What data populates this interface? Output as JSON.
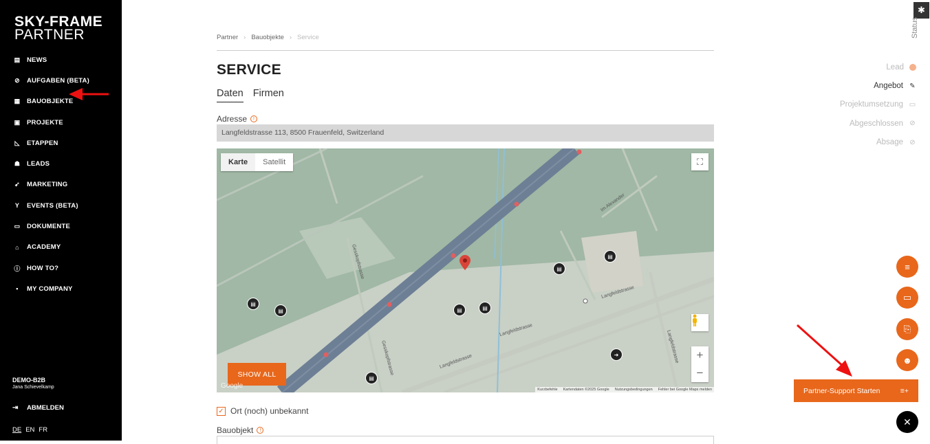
{
  "brand": {
    "line1": "SKY-FRAME",
    "line2": "PARTNER"
  },
  "nav": [
    {
      "label": "NEWS",
      "icon": "newspaper-icon",
      "glyph": "▤"
    },
    {
      "label": "AUFGABEN (BETA)",
      "icon": "check-circle-icon",
      "glyph": "⊘"
    },
    {
      "label": "BAUOBJEKTE",
      "icon": "building-icon",
      "glyph": "▦"
    },
    {
      "label": "PROJEKTE",
      "icon": "layers-icon",
      "glyph": "▣"
    },
    {
      "label": "ETAPPEN",
      "icon": "stairs-icon",
      "glyph": "◺"
    },
    {
      "label": "LEADS",
      "icon": "people-icon",
      "glyph": "☗"
    },
    {
      "label": "MARKETING",
      "icon": "megaphone-icon",
      "glyph": "➹"
    },
    {
      "label": "EVENTS (BETA)",
      "icon": "cocktail-icon",
      "glyph": "Y"
    },
    {
      "label": "DOKUMENTE",
      "icon": "document-icon",
      "glyph": "▭"
    },
    {
      "label": "ACADEMY",
      "icon": "academy-icon",
      "glyph": "⌂"
    },
    {
      "label": "HOW TO?",
      "icon": "info-icon",
      "glyph": "ⓘ"
    },
    {
      "label": "MY COMPANY",
      "icon": "company-icon",
      "glyph": "▪"
    }
  ],
  "user": {
    "org": "DEMO-B2B",
    "name": "Jana Schievelkamp"
  },
  "logout": "ABMELDEN",
  "languages": {
    "de": "DE",
    "en": "EN",
    "fr": "FR"
  },
  "breadcrumb": {
    "a": "Partner",
    "b": "Bauobjekte",
    "c": "Service"
  },
  "page_title": "SERVICE",
  "tabs": {
    "daten": "Daten",
    "firmen": "Firmen"
  },
  "address": {
    "label": "Adresse",
    "value": "Langfeldstrasse 113, 8500 Frauenfeld, Switzerland"
  },
  "map": {
    "type_map": "Karte",
    "type_satellite": "Satellit",
    "show_all": "SHOW ALL",
    "google": "Google",
    "attribution": {
      "shortcuts": "Kurzbefehle",
      "data": "Kartendaten ©2025 Google",
      "terms": "Nutzungsbedingungen",
      "report": "Fehler bei Google Maps melden"
    },
    "streets": {
      "gesskopf1": "Gesskopfstrasse",
      "gesskopf2": "Gesskopfstrasse",
      "langfeld1": "Langfeldstrasse",
      "langfeld2": "Langfeldstrasse",
      "langfeld3": "Langfeldstrasse",
      "langfeld4": "Langfeldstrasse",
      "alexander": "Im Alexander"
    }
  },
  "unknown_location": {
    "label": "Ort (noch) unbekannt",
    "checked": true
  },
  "bauobjekt_label": "Bauobjekt",
  "status": {
    "header": "Status",
    "items": [
      {
        "label": "Lead",
        "icon": "dot-icon",
        "state": "done"
      },
      {
        "label": "Angebot",
        "icon": "document-edit-icon",
        "state": "current"
      },
      {
        "label": "Projektumsetzung",
        "icon": "briefcase-icon",
        "state": "pending"
      },
      {
        "label": "Abgeschlossen",
        "icon": "check-circle-icon",
        "state": "pending"
      },
      {
        "label": "Absage",
        "icon": "cancel-icon",
        "state": "pending"
      }
    ]
  },
  "support": {
    "label": "Partner-Support Starten"
  },
  "colors": {
    "accent": "#e8671b",
    "sidebar": "#000000",
    "map_bg": "#a0b8a5",
    "highway": "#6d7f95"
  }
}
